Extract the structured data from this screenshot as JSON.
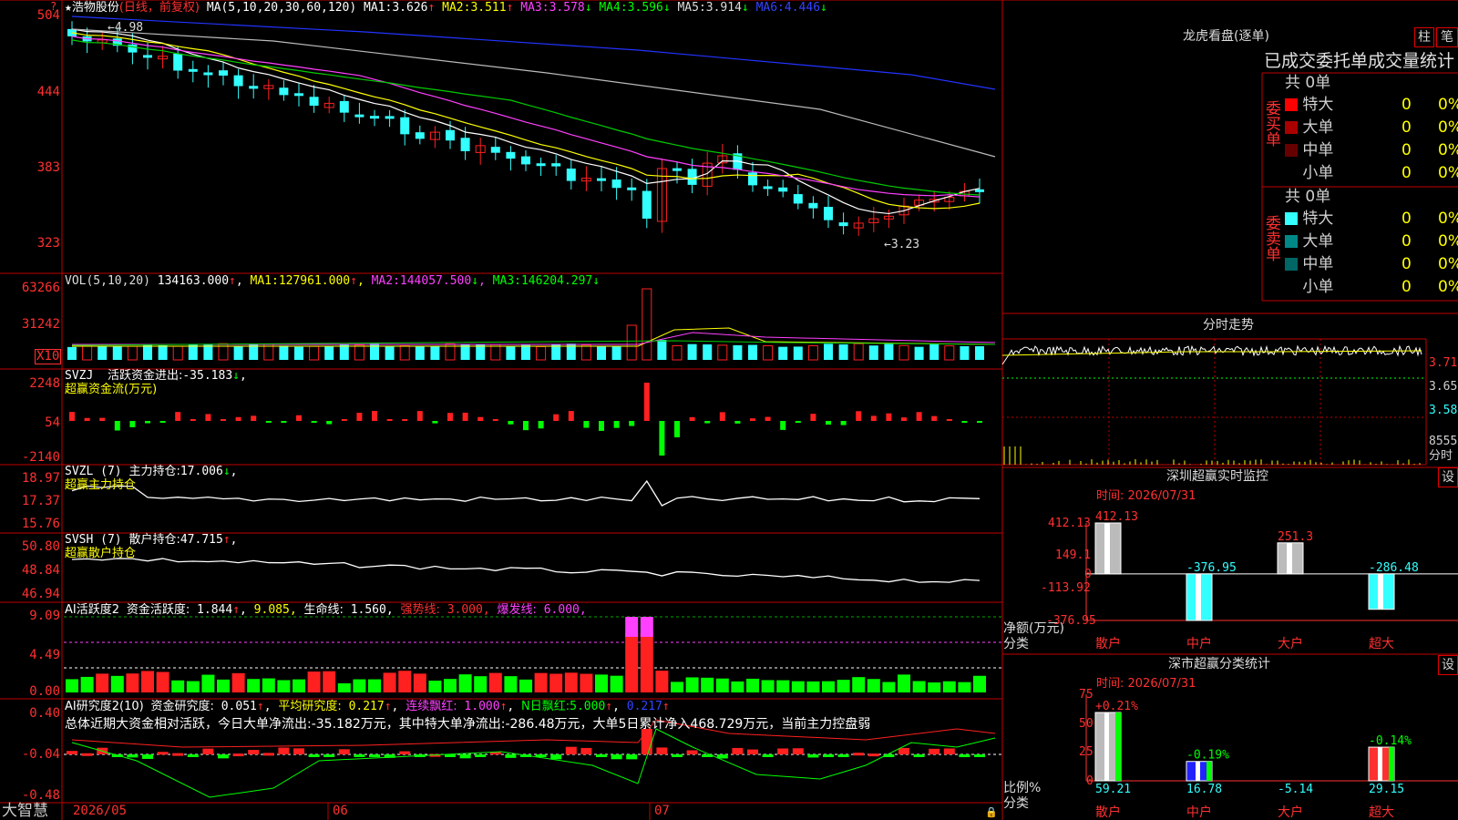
{
  "colors": {
    "up": "#ff2020",
    "down": "#33ffff",
    "ma1": "#ffffff",
    "ma2": "#ffff00",
    "ma3": "#ff40ff",
    "ma4": "#00cc00",
    "ma5": "#bbbbbb",
    "ma6": "#2233ff",
    "border": "#c00000"
  },
  "header": {
    "star": "★",
    "name": "浩物股份",
    "period": "(日线，前复权)",
    "ma_label": "MA(5,10,20,30,60,120)",
    "ma": [
      {
        "label": "MA1:",
        "value": "3.626",
        "arrow": "↑"
      },
      {
        "label": "MA2:",
        "value": "3.511",
        "arrow": "↑"
      },
      {
        "label": "MA3:",
        "value": "3.578",
        "arrow": "↓"
      },
      {
        "label": "MA4:",
        "value": "3.596",
        "arrow": "↓"
      },
      {
        "label": "MA5:",
        "value": "3.914",
        "arrow": "↓"
      },
      {
        "label": "MA6:",
        "value": "4.446",
        "arrow": "↓"
      }
    ]
  },
  "price_axis": [
    "504",
    "444",
    "383",
    "323"
  ],
  "price_high_label": "←4.98",
  "price_low_label": "←3.23",
  "vol": {
    "title": "VOL(5,10,20)",
    "value": "134163.000",
    "arrow": "↑",
    "ma": [
      {
        "label": "MA1:",
        "value": "127961.000",
        "arrow": "↑"
      },
      {
        "label": "MA2:",
        "value": "144057.500",
        "arrow": "↓"
      },
      {
        "label": "MA3:",
        "value": "146204.297",
        "arrow": "↓"
      }
    ],
    "axis": [
      "63266",
      "31242"
    ],
    "unit": "X10"
  },
  "svzj": {
    "title": "SVZJ",
    "label": "活跃资金进出:",
    "value": "-35.183",
    "arrow": "↓",
    "suffix": ",",
    "subtitle": "超赢资金流(万元)",
    "axis": [
      "2248",
      "54",
      "-2140"
    ]
  },
  "svzl": {
    "title": "SVZL (7)",
    "label": "主力持仓:",
    "value": "17.006",
    "arrow": "↓",
    "suffix": ",",
    "subtitle": "超赢主力持仓",
    "axis": [
      "18.97",
      "17.37",
      "15.76"
    ]
  },
  "svsh": {
    "title": "SVSH (7)",
    "label": "散户持仓:",
    "value": "47.715",
    "arrow": "↑",
    "suffix": ",",
    "subtitle": "超赢散户持仓",
    "axis": [
      "50.80",
      "48.84",
      "46.94"
    ]
  },
  "ai1": {
    "title": "AI活跃度2",
    "label": "资金活跃度:",
    "value": "1.844",
    "arrow": "↑",
    "v2": "9.085",
    "l3": "生命线:",
    "v3": "1.560",
    "l4": "强势线:",
    "v4": "3.000",
    "l5": "爆发线:",
    "v5": "6.000",
    "axis": [
      "9.09",
      "4.49",
      "0.00"
    ]
  },
  "ai2": {
    "title": "AI研究度2(10)",
    "label": "资金研究度:",
    "value": "0.051",
    "arrow": "↑",
    "l2": "平均研究度:",
    "v2": "0.217",
    "l3": "连续飘红:",
    "v3": "1.000",
    "l4": "N日飘红:",
    "v4": "5.000",
    "v5": "0.217",
    "axis": [
      "0.40",
      "-0.04",
      "-0.48"
    ],
    "summary": "总体近期大资金相对活跃，今日大单净流出:-35.182万元，其中特大单净流出:-286.48万元，大单5日累计净入468.729万元，当前主力控盘弱"
  },
  "date_axis": [
    "2026/05",
    "06",
    "07"
  ],
  "footer": {
    "brand": "大智慧"
  },
  "orderbook": {
    "title": "龙虎看盘(逐单)",
    "btn1": "柱",
    "btn2": "笔",
    "subtitle": "已成交委托单成交量统计",
    "buy": {
      "side": "委买单",
      "total": "共 0单",
      "rows": [
        {
          "label": "特大",
          "count": "0",
          "pct": "0%"
        },
        {
          "label": "大单",
          "count": "0",
          "pct": "0%"
        },
        {
          "label": "中单",
          "count": "0",
          "pct": "0%"
        },
        {
          "label": "小单",
          "count": "0",
          "pct": "0%"
        }
      ]
    },
    "sell": {
      "side": "委卖单",
      "total": "共 0单",
      "rows": [
        {
          "label": "特大",
          "count": "0",
          "pct": "0%"
        },
        {
          "label": "大单",
          "count": "0",
          "pct": "0%"
        },
        {
          "label": "中单",
          "count": "0",
          "pct": "0%"
        },
        {
          "label": "小单",
          "count": "0",
          "pct": "0%"
        }
      ]
    }
  },
  "intraday": {
    "title": "分时走势",
    "axis": [
      "3.715",
      "3.650",
      "3.585"
    ],
    "vol_value": "8555",
    "vol_label": "分时"
  },
  "sz_monitor": {
    "title": "深圳超赢实时监控",
    "settings": "设",
    "time": "时间: 2026/07/31",
    "axis": [
      "412.13",
      "149.1",
      "0",
      "-113.92",
      "-376.95"
    ],
    "y_title": "净额(万元)",
    "x_title": "分类",
    "chart_data": {
      "type": "bar",
      "categories": [
        "散户",
        "中户",
        "大户",
        "超大"
      ],
      "values": [
        412.13,
        -376.95,
        251.3,
        -286.48
      ],
      "labels": [
        "412.13",
        "-376.95",
        "251.3",
        "-286.48"
      ],
      "ylim": [
        -376.95,
        412.13
      ]
    }
  },
  "sz_category": {
    "title": "深市超赢分类统计",
    "settings": "设",
    "time": "时间: 2026/07/31",
    "axis": [
      "75",
      "50",
      "25",
      "0"
    ],
    "y_title": "比例%",
    "x_title": "分类",
    "chart_data": {
      "type": "bar",
      "categories": [
        "散户",
        "中户",
        "大户",
        "超大"
      ],
      "values": [
        59.21,
        16.78,
        -5.14,
        29.15
      ],
      "top_labels": [
        "+0.21%",
        "-0.19%",
        "",
        "-0.14%"
      ],
      "ylim": [
        0,
        75
      ]
    }
  }
}
